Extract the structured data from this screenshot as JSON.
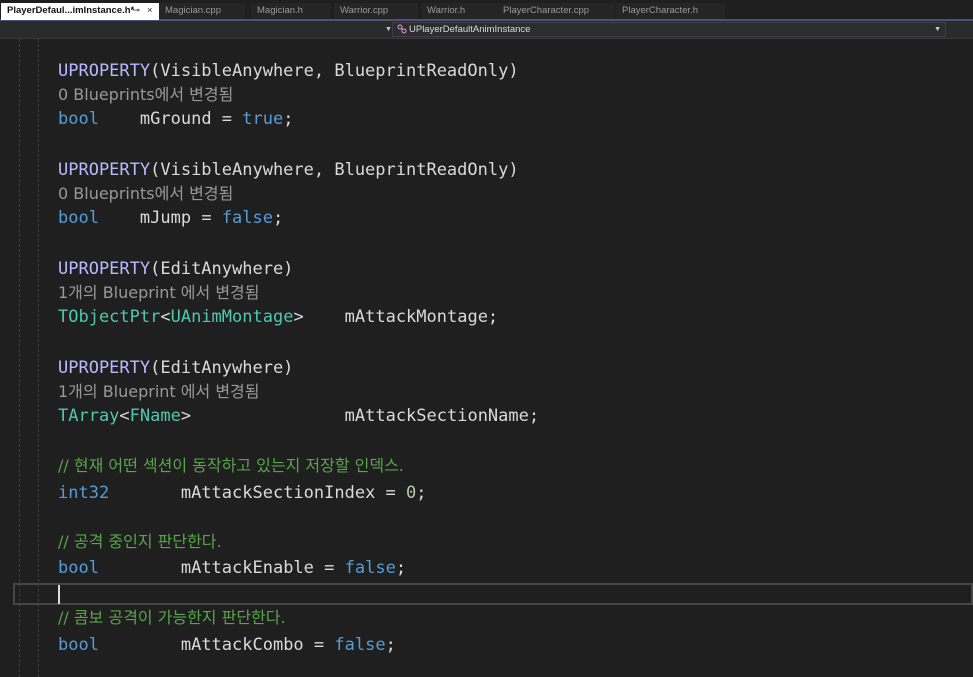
{
  "tabs": [
    {
      "label": "PlayerDefaul...imInstance.h*",
      "active": true,
      "pin": "⊸",
      "close": "×"
    },
    {
      "label": "Magician.cpp"
    },
    {
      "label": "Magician.h"
    },
    {
      "label": "Warrior.cpp"
    },
    {
      "label": "Warrior.h"
    },
    {
      "label": "PlayerCharacter.cpp"
    },
    {
      "label": "PlayerCharacter.h"
    }
  ],
  "navigation": {
    "class_dropdown": "UPlayerDefaultAnimInstance",
    "icon": "class-icon"
  },
  "code": {
    "b1": {
      "macro": "UPROPERTY",
      "args": "(VisibleAnywhere, BlueprintReadOnly)",
      "hint": "0 Blueprints에서 변경됨",
      "type": "bool",
      "gap": "    ",
      "name": "mGround",
      "eq": " = ",
      "value": "true",
      "end": ";"
    },
    "b2": {
      "macro": "UPROPERTY",
      "args": "(VisibleAnywhere, BlueprintReadOnly)",
      "hint": "0 Blueprints에서 변경됨",
      "type": "bool",
      "gap": "    ",
      "name": "mJump",
      "eq": " = ",
      "value": "false",
      "end": ";"
    },
    "b3": {
      "macro": "UPROPERTY",
      "args": "(EditAnywhere)",
      "hint": "1개의 Blueprint 에서 변경됨",
      "type": "TObjectPtr",
      "lt": "<",
      "inner": "UAnimMontage",
      "gt": ">",
      "gap": "    ",
      "name": "mAttackMontage;"
    },
    "b4": {
      "macro": "UPROPERTY",
      "args": "(EditAnywhere)",
      "hint": "1개의 Blueprint 에서 변경됨",
      "type": "TArray",
      "lt": "<",
      "inner": "FName",
      "gt": ">",
      "gap": "               ",
      "name": "mAttackSectionName;"
    },
    "c1": {
      "comment": "// 현재 어떤 섹션이 동작하고 있는지 저장할 인덱스.",
      "type": "int32",
      "gap": "       ",
      "name": "mAttackSectionIndex",
      "eq": " = ",
      "value": "0",
      "end": ";"
    },
    "c2": {
      "comment": "// 공격 중인지 판단한다.",
      "type": "bool",
      "gap": "        ",
      "name": "mAttackEnable",
      "eq": " = ",
      "value": "false",
      "end": ";"
    },
    "c3": {
      "comment": "// 콤보 공격이 가능한지 판단한다.",
      "type": "bool",
      "gap": "        ",
      "name": "mAttackCombo",
      "eq": " = ",
      "value": "false",
      "end": ";"
    }
  },
  "colors": {
    "macro": "#beb7ff",
    "keyword": "#569cd6",
    "type": "#4ec9b0",
    "number": "#b5cea8",
    "comment": "#57a64a",
    "hint": "#999999",
    "background": "#1f1f1f"
  }
}
